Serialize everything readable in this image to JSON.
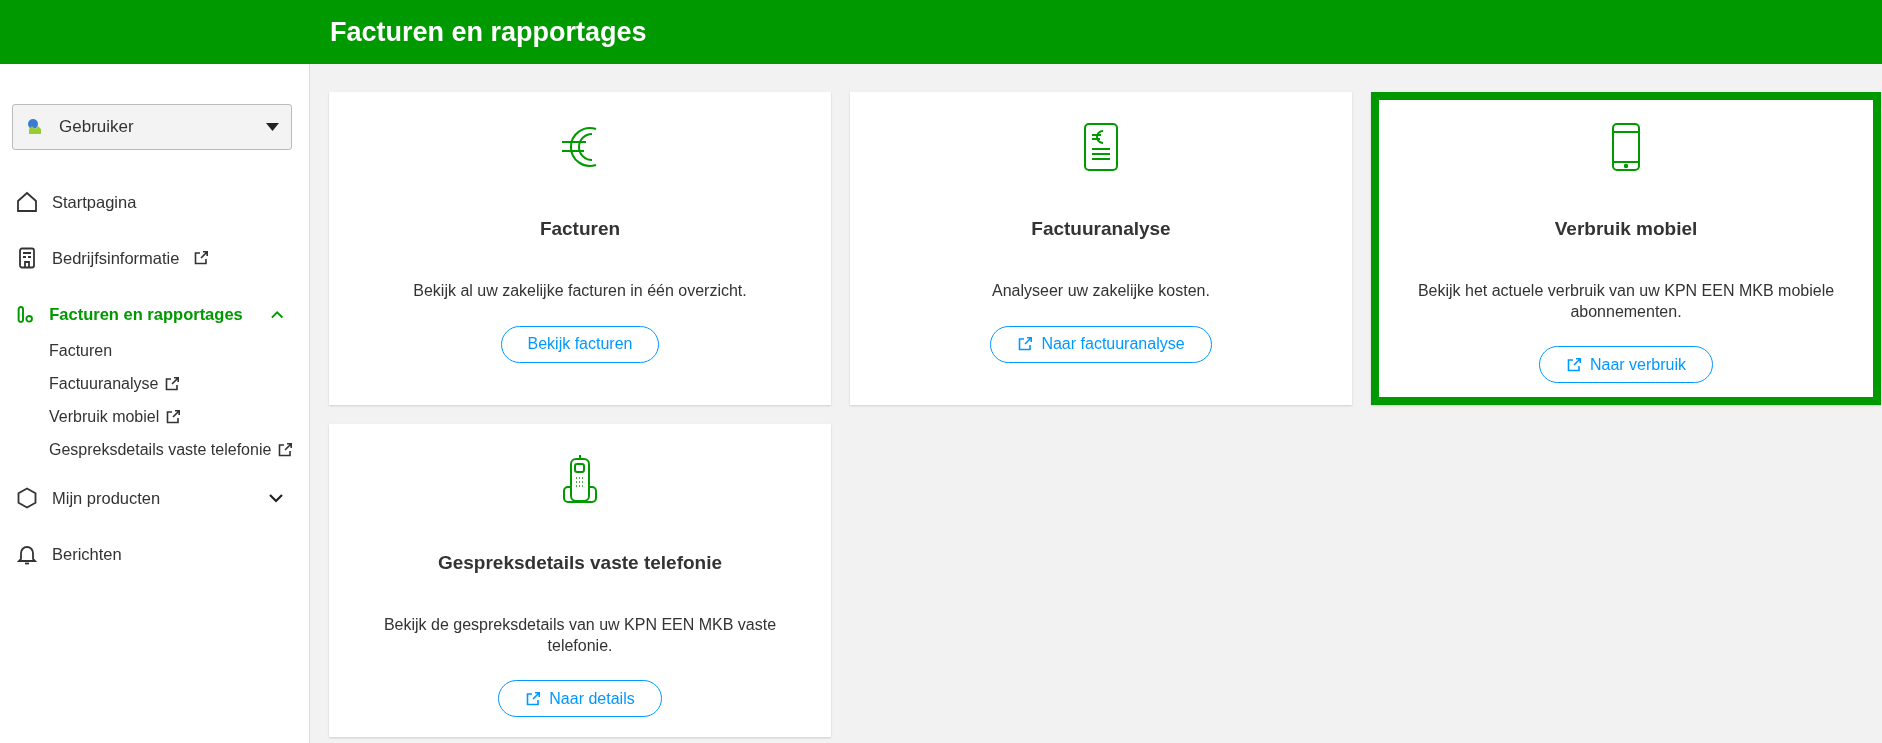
{
  "header": {
    "title": "Facturen en rapportages"
  },
  "user_menu": {
    "label": "Gebruiker"
  },
  "sidebar": {
    "items": [
      {
        "label": "Startpagina",
        "external": false,
        "selected": false
      },
      {
        "label": "Bedrijfsinformatie",
        "external": true,
        "selected": false
      },
      {
        "label": "Facturen en rapportages",
        "external": false,
        "selected": true,
        "expanded": true,
        "children": [
          {
            "label": "Facturen",
            "external": false
          },
          {
            "label": "Factuuranalyse",
            "external": true
          },
          {
            "label": "Verbruik mobiel",
            "external": true
          },
          {
            "label": "Gespreksdetails vaste telefonie",
            "external": true
          }
        ]
      },
      {
        "label": "Mijn producten",
        "external": false,
        "selected": false,
        "expanded": false
      },
      {
        "label": "Berichten",
        "external": false,
        "selected": false
      }
    ]
  },
  "cards": [
    {
      "title": "Facturen",
      "description": "Bekijk al uw zakelijke facturen in één overzicht.",
      "button": "Bekijk facturen",
      "external": false,
      "selected": false
    },
    {
      "title": "Factuuranalyse",
      "description": "Analyseer uw zakelijke kosten.",
      "button": "Naar factuuranalyse",
      "external": true,
      "selected": false
    },
    {
      "title": "Verbruik mobiel",
      "description": "Bekijk het actuele verbruik van uw KPN EEN MKB mobiele abonnementen.",
      "button": "Naar verbruik",
      "external": true,
      "selected": true
    },
    {
      "title": "Gespreksdetails vaste telefonie",
      "description": "Bekijk de gespreksdetails van uw KPN EEN MKB vaste telefonie.",
      "button": "Naar details",
      "external": true,
      "selected": false
    }
  ]
}
